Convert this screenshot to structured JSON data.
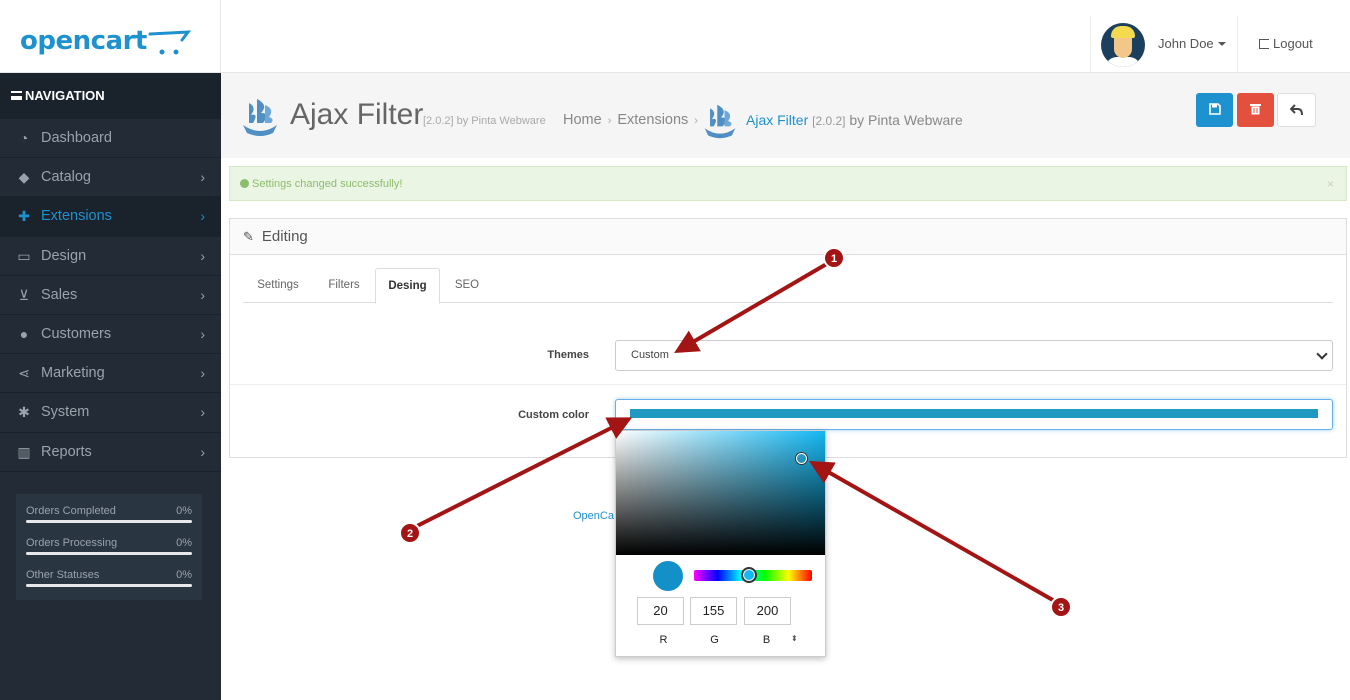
{
  "header": {
    "logo": "opencart",
    "user": {
      "name": "John Doe"
    },
    "logout": "Logout"
  },
  "sidebar": {
    "nav_title": "NAVIGATION",
    "items": [
      {
        "label": "Dashboard",
        "icon": "dashboard-icon",
        "chevron": false,
        "active": false
      },
      {
        "label": "Catalog",
        "icon": "tag-icon",
        "chevron": true,
        "active": false
      },
      {
        "label": "Extensions",
        "icon": "puzzle-icon",
        "chevron": true,
        "active": true
      },
      {
        "label": "Design",
        "icon": "monitor-icon",
        "chevron": true,
        "active": false
      },
      {
        "label": "Sales",
        "icon": "cart-icon",
        "chevron": true,
        "active": false
      },
      {
        "label": "Customers",
        "icon": "user-icon",
        "chevron": true,
        "active": false
      },
      {
        "label": "Marketing",
        "icon": "share-icon",
        "chevron": true,
        "active": false
      },
      {
        "label": "System",
        "icon": "gear-icon",
        "chevron": true,
        "active": false
      },
      {
        "label": "Reports",
        "icon": "bar-chart-icon",
        "chevron": true,
        "active": false
      }
    ],
    "stats": [
      {
        "label": "Orders Completed",
        "value": "0%"
      },
      {
        "label": "Orders Processing",
        "value": "0%"
      },
      {
        "label": "Other Statuses",
        "value": "0%"
      }
    ]
  },
  "page": {
    "title": "Ajax Filter",
    "version": "[2.0.2] by Pinta Webware",
    "breadcrumb": [
      "Home",
      "Extensions"
    ],
    "breadcrumb_current": "Ajax Filter",
    "breadcrumb_current_version": "[2.0.2]",
    "breadcrumb_current_by": "by Pinta Webware"
  },
  "alert": {
    "text": "Settings changed successfully!",
    "close": "×"
  },
  "panel": {
    "heading": "Editing",
    "tabs": [
      "Settings",
      "Filters",
      "Desing",
      "SEO"
    ],
    "active_tab": "Desing",
    "themes_label": "Themes",
    "themes_value": "Custom",
    "custom_color_label": "Custom color",
    "custom_color_hex": "#209ac0"
  },
  "footer_partial": "OpenCa",
  "color_picker": {
    "r": "20",
    "g": "155",
    "b": "200",
    "r_label": "R",
    "g_label": "G",
    "b_label": "B",
    "spin": "⬍"
  },
  "annotations": [
    "1",
    "2",
    "3"
  ],
  "colors": {
    "accent": "#1e91cf",
    "danger": "#e3503e",
    "sidebar": "#222b36",
    "annotation": "#a31414"
  }
}
